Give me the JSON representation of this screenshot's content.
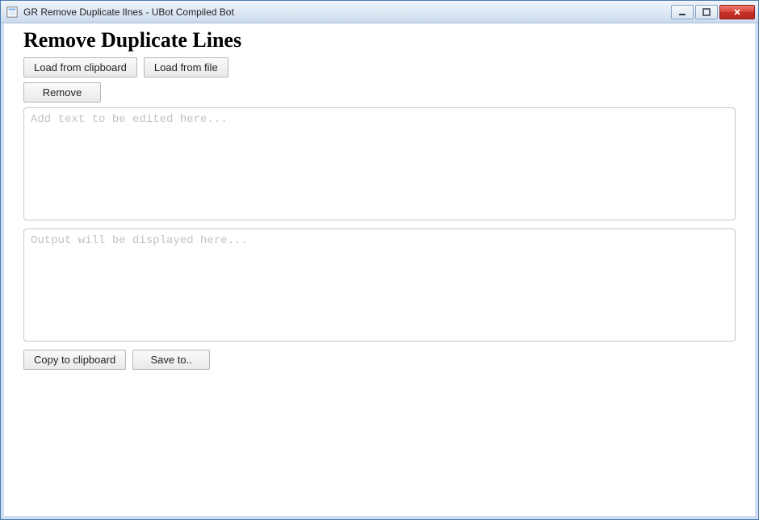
{
  "window": {
    "title": "GR Remove Duplicate lInes - UBot Compiled Bot"
  },
  "heading": "Remove Duplicate Lines",
  "buttons": {
    "load_clipboard": "Load from clipboard",
    "load_file": "Load from file",
    "remove": "Remove",
    "copy_clipboard": "Copy to clipboard",
    "save_to": "Save to.."
  },
  "textareas": {
    "input_value": "",
    "input_placeholder": "Add text to be edited here...",
    "output_value": "",
    "output_placeholder": "Output will be displayed here..."
  }
}
